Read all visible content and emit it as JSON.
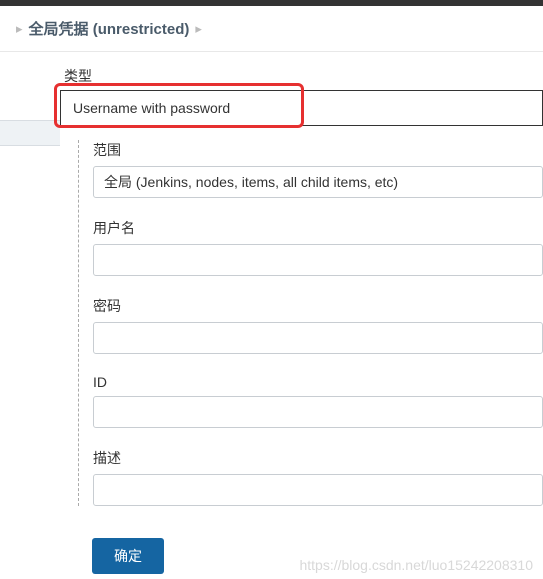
{
  "breadcrumb": {
    "label": "全局凭据 (unrestricted)"
  },
  "form": {
    "type_label": "类型",
    "type_value": "Username with password",
    "scope_label": "范围",
    "scope_value": "全局 (Jenkins, nodes, items, all child items, etc)",
    "username_label": "用户名",
    "username_value": "",
    "password_label": "密码",
    "password_value": "",
    "id_label": "ID",
    "id_value": "",
    "description_label": "描述",
    "description_value": "",
    "submit_label": "确定"
  },
  "watermark": "https://blog.csdn.net/luo15242208310"
}
